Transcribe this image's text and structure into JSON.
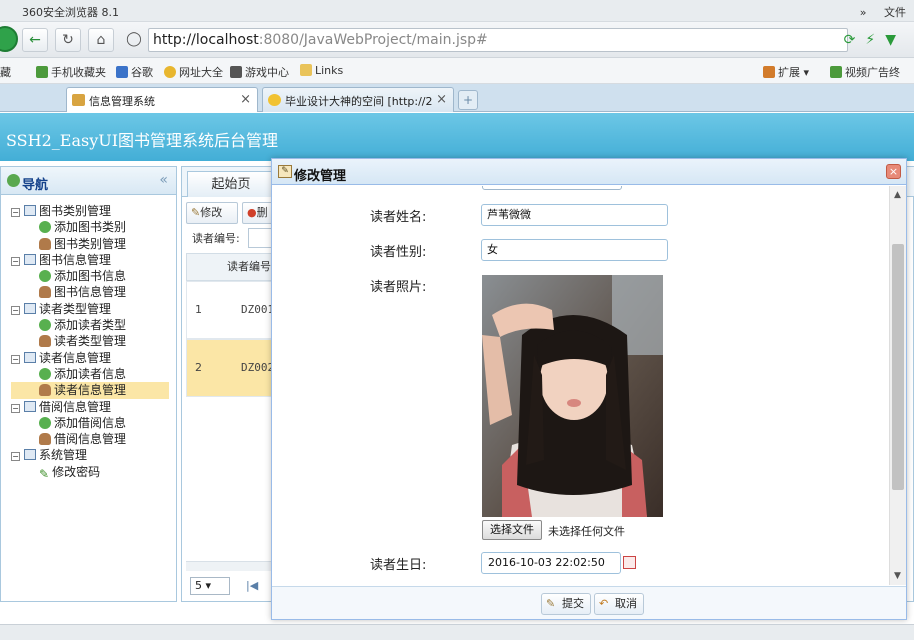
{
  "browser": {
    "title": "360安全浏览器 8.1",
    "title_controls": [
      "»",
      "文件"
    ],
    "url_host": "http://localhost",
    "url_path": ":8080/JavaWebProject/main.jsp#",
    "bookmarks": [
      {
        "label": "藏",
        "icon": "star-icon"
      },
      {
        "label": "手机收藏夹",
        "icon": "phone-icon"
      },
      {
        "label": "谷歌",
        "icon": "google-icon"
      },
      {
        "label": "网址大全",
        "icon": "globe-icon"
      },
      {
        "label": "游戏中心",
        "icon": "gamepad-icon"
      },
      {
        "label": "Links",
        "icon": "folder-icon"
      },
      {
        "label": "扩展",
        "icon": "grid-icon"
      },
      {
        "label": "视频广告终",
        "icon": "shield-icon"
      }
    ],
    "tabs": [
      {
        "label": "信息管理系统",
        "active": true
      },
      {
        "label": "毕业设计大神的空间 [http://2",
        "active": false
      }
    ]
  },
  "app": {
    "header_title": "SSH2_EasyUI图书管理系统后台管理"
  },
  "nav": {
    "title": "导航",
    "collapse_glyph": "«",
    "tree": [
      {
        "label": "图书类别管理",
        "level": 0
      },
      {
        "label": "添加图书类别",
        "level": 1,
        "icon": "add"
      },
      {
        "label": "图书类别管理",
        "level": 1,
        "icon": "user"
      },
      {
        "label": "图书信息管理",
        "level": 0
      },
      {
        "label": "添加图书信息",
        "level": 1,
        "icon": "add"
      },
      {
        "label": "图书信息管理",
        "level": 1,
        "icon": "user"
      },
      {
        "label": "读者类型管理",
        "level": 0
      },
      {
        "label": "添加读者类型",
        "level": 1,
        "icon": "add"
      },
      {
        "label": "读者类型管理",
        "level": 1,
        "icon": "user"
      },
      {
        "label": "读者信息管理",
        "level": 0
      },
      {
        "label": "添加读者信息",
        "level": 1,
        "icon": "add"
      },
      {
        "label": "读者信息管理",
        "level": 1,
        "icon": "user",
        "selected": true
      },
      {
        "label": "借阅信息管理",
        "level": 0
      },
      {
        "label": "添加借阅信息",
        "level": 1,
        "icon": "add"
      },
      {
        "label": "借阅信息管理",
        "level": 1,
        "icon": "user"
      },
      {
        "label": "系统管理",
        "level": 0
      },
      {
        "label": "修改密码",
        "level": 1,
        "icon": "pen"
      }
    ]
  },
  "center": {
    "tab_label": "起始页",
    "toolbar": {
      "edit_label": "修改",
      "delete_label": "删"
    },
    "search_label": "读者编号:",
    "column_header": "读者编号",
    "rows": [
      {
        "num": "1",
        "value": "DZ001",
        "selected": false
      },
      {
        "num": "2",
        "value": "DZ002",
        "selected": true
      }
    ],
    "page_size": "5"
  },
  "dialog": {
    "title": "修改管理",
    "fields": {
      "name_label": "读者姓名:",
      "name_value": "芦苇微微",
      "sex_label": "读者性别:",
      "sex_value": "女",
      "photo_label": "读者照片:",
      "file_button": "选择文件",
      "file_status": "未选择任何文件",
      "birthday_label": "读者生日:",
      "birthday_value": "2016-10-03 22:02:50"
    },
    "buttons": {
      "submit": "提交",
      "cancel": "取消"
    }
  }
}
